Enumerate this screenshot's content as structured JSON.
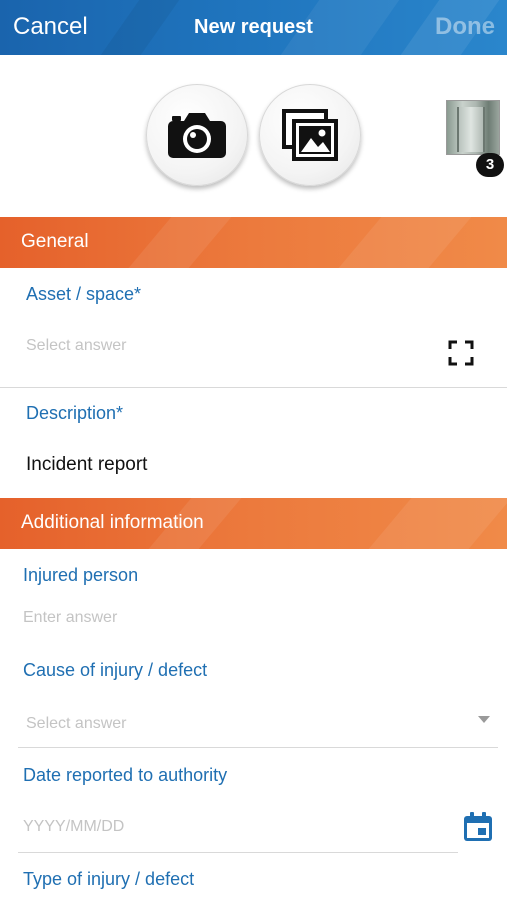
{
  "header": {
    "cancel_label": "Cancel",
    "title": "New request",
    "done_label": "Done"
  },
  "media": {
    "camera_icon": "camera-icon",
    "gallery_icon": "photo-gallery-icon",
    "attachment_count": "3"
  },
  "sections": {
    "general": "General",
    "additional": "Additional information"
  },
  "fields": {
    "asset": {
      "label": "Asset / space*",
      "placeholder": "Select answer",
      "icon": "scan-icon"
    },
    "description": {
      "label": "Description*",
      "value": "Incident report"
    },
    "injured_person": {
      "label": "Injured person",
      "placeholder": "Enter answer"
    },
    "cause": {
      "label": "Cause of injury / defect",
      "placeholder": "Select answer",
      "icon": "dropdown-arrow-icon"
    },
    "date_reported": {
      "label": "Date reported to authority",
      "placeholder": "YYYY/MM/DD",
      "icon": "calendar-icon"
    },
    "injury_type": {
      "label": "Type of injury / defect"
    }
  },
  "colors": {
    "header_blue": "#1f74bd",
    "section_orange": "#ec7a3d",
    "label_blue": "#1f6fb2",
    "placeholder_gray": "#c4c4c4"
  }
}
